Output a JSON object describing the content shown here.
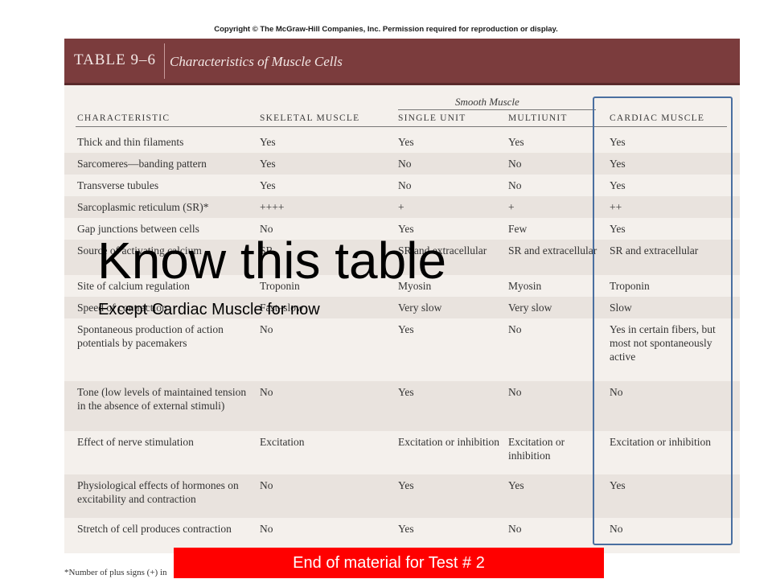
{
  "copyright": "Copyright © The McGraw-Hill Companies, Inc. Permission required for reproduction or display.",
  "table": {
    "number": "TABLE 9–6",
    "title": "Characteristics of Muscle Cells",
    "group_header": "Smooth Muscle",
    "columns": [
      "CHARACTERISTIC",
      "SKELETAL MUSCLE",
      "SINGLE UNIT",
      "MULTIUNIT",
      "CARDIAC MUSCLE"
    ],
    "rows": [
      [
        "Thick and thin filaments",
        "Yes",
        "Yes",
        "Yes",
        "Yes"
      ],
      [
        "Sarcomeres—banding pattern",
        "Yes",
        "No",
        "No",
        "Yes"
      ],
      [
        "Transverse tubules",
        "Yes",
        "No",
        "No",
        "Yes"
      ],
      [
        "Sarcoplasmic reticulum (SR)*",
        "++++",
        "+",
        "+",
        "++"
      ],
      [
        "Gap junctions between cells",
        "No",
        "Yes",
        "Few",
        "Yes"
      ],
      [
        "Source of activating calcium",
        "SR",
        "SR and extracellular",
        "SR and extracellular",
        "SR and extracellular"
      ],
      [
        "Site of calcium regulation",
        "Troponin",
        "Myosin",
        "Myosin",
        "Troponin"
      ],
      [
        "Speed of contraction",
        "Fast–slow",
        "Very slow",
        "Very slow",
        "Slow"
      ],
      [
        "Spontaneous production of action potentials by pacemakers",
        "No",
        "Yes",
        "No",
        "Yes in certain fibers, but most not spontaneously active"
      ],
      [
        "Tone (low levels of maintained tension in the absence of external stimuli)",
        "No",
        "Yes",
        "No",
        "No"
      ],
      [
        "Effect of nerve stimulation",
        "Excitation",
        "Excitation or inhibition",
        "Excitation or inhibition",
        "Excitation or inhibition"
      ],
      [
        "Physiological effects of hormones on excitability and contraction",
        "No",
        "Yes",
        "Yes",
        "Yes"
      ],
      [
        "Stretch of cell produces contraction",
        "No",
        "Yes",
        "No",
        "No"
      ]
    ],
    "footnote": "*Number of plus signs (+) in"
  },
  "overlay": {
    "title": "Know this table",
    "subtitle": "Except Cardiac Muscle for now"
  },
  "end_banner": "End of material for Test # 2",
  "colors": {
    "banner": "#7b3c3d",
    "highlight_box": "#4a6fa0",
    "end_banner": "#ff0000"
  }
}
